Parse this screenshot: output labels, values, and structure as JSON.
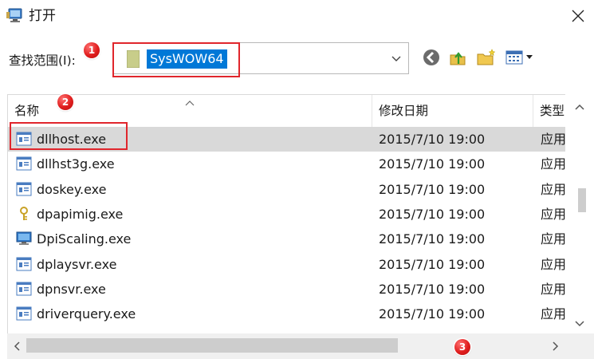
{
  "window": {
    "title": "打开",
    "close_glyph": "✕"
  },
  "toolbar": {
    "look_in_label": "查找范围(I):",
    "location_value": "SysWOW64",
    "icons": [
      "back-icon",
      "up-folder-icon",
      "new-folder-icon",
      "view-menu-icon"
    ]
  },
  "columns": {
    "name": "名称",
    "date": "修改日期",
    "type": "类型"
  },
  "files": [
    {
      "name": "dllhost.exe",
      "date": "2015/7/10 19:00",
      "type": "应用",
      "icon": "app-icon",
      "selected": true
    },
    {
      "name": "dllhst3g.exe",
      "date": "2015/7/10 19:00",
      "type": "应用",
      "icon": "app-icon"
    },
    {
      "name": "doskey.exe",
      "date": "2015/7/10 19:00",
      "type": "应用",
      "icon": "app-icon"
    },
    {
      "name": "dpapimig.exe",
      "date": "2015/7/10 19:00",
      "type": "应用",
      "icon": "key-icon"
    },
    {
      "name": "DpiScaling.exe",
      "date": "2015/7/10 19:00",
      "type": "应用",
      "icon": "monitor-icon"
    },
    {
      "name": "dplaysvr.exe",
      "date": "2015/7/10 19:00",
      "type": "应用",
      "icon": "app-icon"
    },
    {
      "name": "dpnsvr.exe",
      "date": "2015/7/10 19:00",
      "type": "应用",
      "icon": "app-icon"
    },
    {
      "name": "driverquery.exe",
      "date": "2015/7/10 19:00",
      "type": "应用",
      "icon": "app-icon"
    }
  ],
  "annotations": [
    "1",
    "2",
    "3"
  ],
  "colors": {
    "selection": "#0078d7",
    "selected_row": "#d9d9d9",
    "annotation_red": "#e0262c"
  }
}
